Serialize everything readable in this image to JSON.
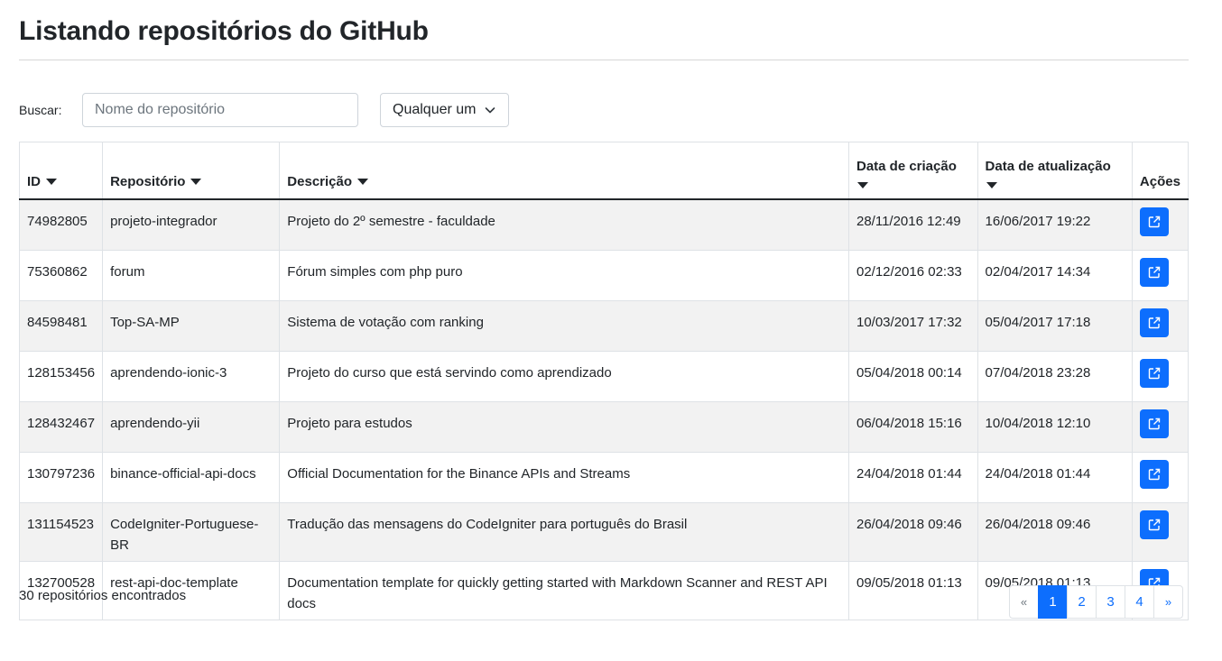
{
  "page": {
    "title": "Listando repositórios do GitHub"
  },
  "filters": {
    "search_label": "Buscar:",
    "search_placeholder": "Nome do repositório",
    "search_value": "",
    "select_value": "Qualquer um"
  },
  "table": {
    "headers": [
      "ID",
      "Repositório",
      "Descrição",
      "Data de criação",
      "Data de atualização",
      "Ações"
    ],
    "rows": [
      {
        "id": "74982805",
        "repo": "projeto-integrador",
        "desc": "Projeto do 2º semestre - faculdade",
        "created": "28/11/2016 12:49",
        "updated": "16/06/2017 19:22"
      },
      {
        "id": "75360862",
        "repo": "forum",
        "desc": "Fórum simples com php puro",
        "created": "02/12/2016 02:33",
        "updated": "02/04/2017 14:34"
      },
      {
        "id": "84598481",
        "repo": "Top-SA-MP",
        "desc": "Sistema de votação com ranking",
        "created": "10/03/2017 17:32",
        "updated": "05/04/2017 17:18"
      },
      {
        "id": "128153456",
        "repo": "aprendendo-ionic-3",
        "desc": "Projeto do curso que está servindo como aprendizado",
        "created": "05/04/2018 00:14",
        "updated": "07/04/2018 23:28"
      },
      {
        "id": "128432467",
        "repo": "aprendendo-yii",
        "desc": "Projeto para estudos",
        "created": "06/04/2018 15:16",
        "updated": "10/04/2018 12:10"
      },
      {
        "id": "130797236",
        "repo": "binance-official-api-docs",
        "desc": "Official Documentation for the Binance APIs and Streams",
        "created": "24/04/2018 01:44",
        "updated": "24/04/2018 01:44"
      },
      {
        "id": "131154523",
        "repo": "CodeIgniter-Portuguese-BR",
        "desc": "Tradução das mensagens do CodeIgniter para português do Brasil",
        "created": "26/04/2018 09:46",
        "updated": "26/04/2018 09:46"
      },
      {
        "id": "132700528",
        "repo": "rest-api-doc-template",
        "desc": "Documentation template for quickly getting started with Markdown Scanner and REST API docs",
        "created": "09/05/2018 01:13",
        "updated": "09/05/2018 01:13"
      }
    ]
  },
  "footer": {
    "count_text": "30 repositórios encontrados",
    "pagination": {
      "prev": "«",
      "pages": [
        "1",
        "2",
        "3",
        "4"
      ],
      "next": "»",
      "active_page": "1"
    }
  },
  "icons": {
    "sort": "caret-down-icon",
    "open": "external-link-icon",
    "select": "chevron-down-icon"
  },
  "colors": {
    "primary": "#0d6efd",
    "stripe": "#f2f2f2",
    "border": "#dee2e6"
  }
}
